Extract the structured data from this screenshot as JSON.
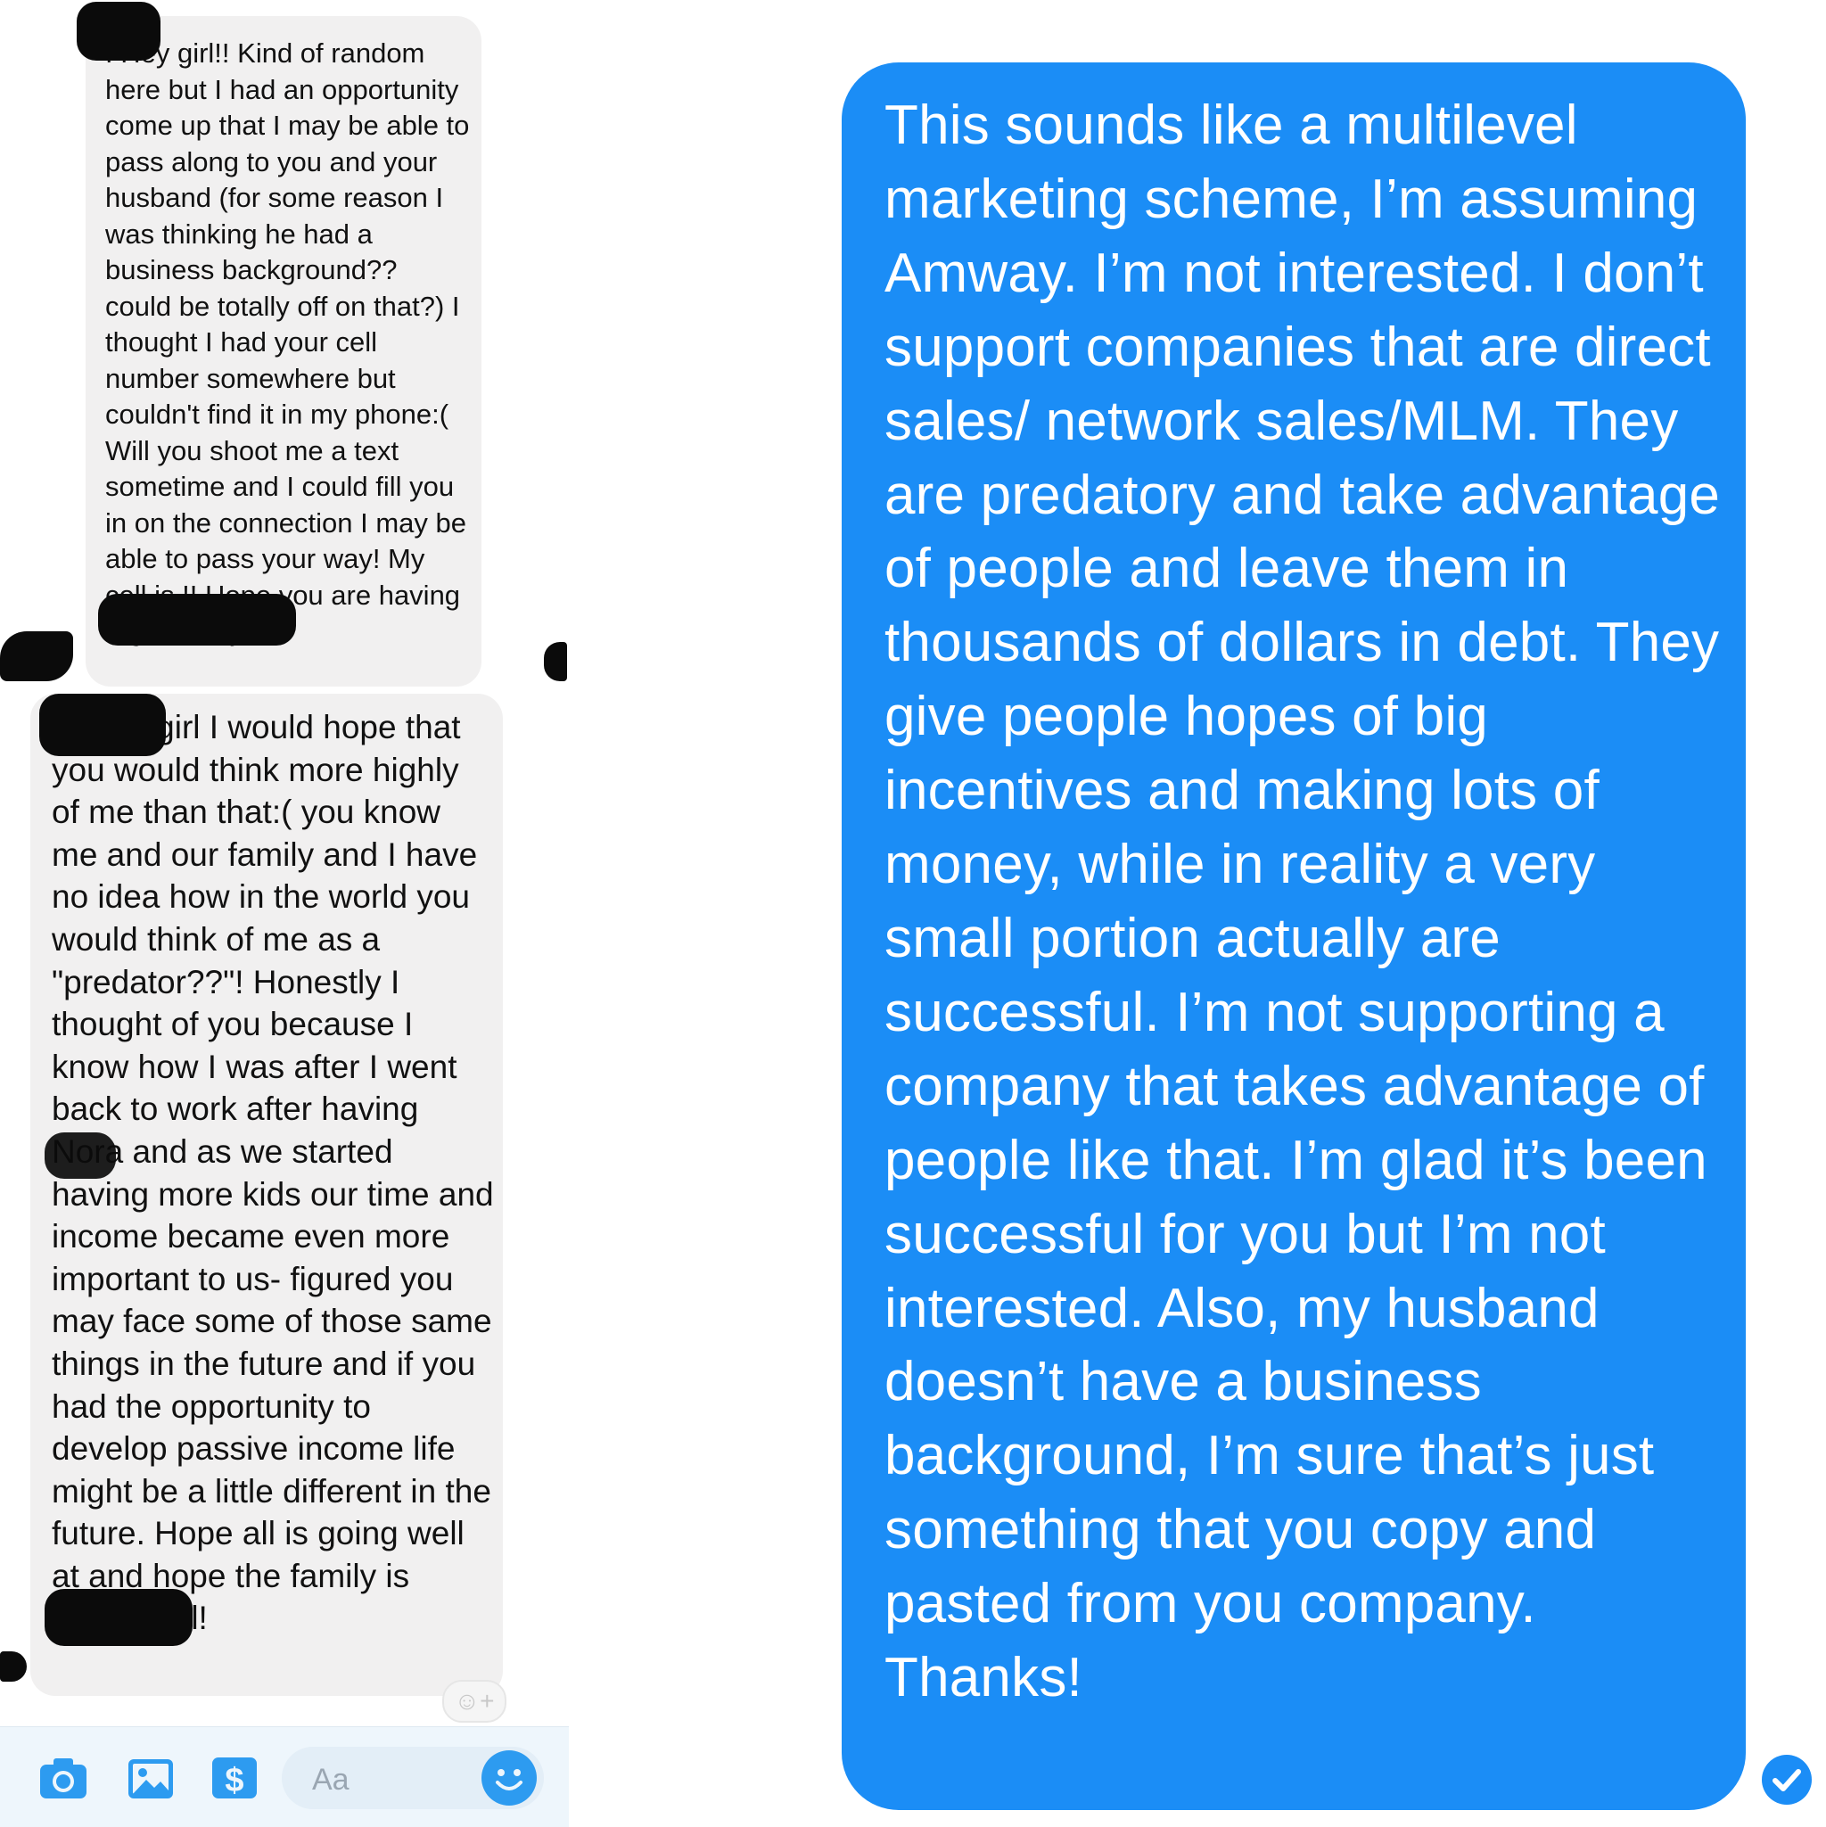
{
  "conversation": {
    "received_1": {
      "text": "! Hey girl!! Kind of random here but I had an opportunity come up that I may be able to pass along to you and your husband (for some reason I was thinking he had a business background?? could be totally off on that?) I thought I had your cell number somewhere but couldn't find it in my phone:( Will you shoot me a text sometime and I could fill you in on the connection I may be able to pass your way! My cell is !! Hope you are having a great day!!!"
    },
    "received_2": {
      "text": "WOW. girl I would hope that you would think more highly of me than that:( you know me and our family and I have no idea how in the world you would think of me as a \"predator??\"! Honestly I thought of you because I know how I was after I went back to work after having Nora and as we started having more kids our time and income became even more important to us- figured you may face some of those same things in the future and if you had the opportunity to develop passive income life might be a little different in the future. Hope all is going well at and hope the family is doing well!"
    },
    "sent_1": {
      "text": "This sounds like a multilevel marketing scheme, I’m assuming Amway. I’m not interested. I don’t support companies that are direct sales/ network sales/MLM. They are predatory and take advantage of people and leave them in thousands of dollars in debt. They give people hopes of big incentives and making lots of money, while in reality a very small portion actually are successful. I’m not supporting a company that takes advantage of people like that. I’m glad it’s been successful for you but I’m not interested. Also, my husband doesn’t have a business background, I’m sure that’s just something that you copy and pasted from you company. Thanks!"
    }
  },
  "composer": {
    "placeholder": "Aa",
    "tools": [
      "camera-icon",
      "photo-icon",
      "payment-icon",
      "emoji-icon"
    ]
  },
  "reaction_icon": "add-reaction-icon",
  "status_icon": "seen-check-icon",
  "colors": {
    "sent_bubble": "#1b8df6",
    "received_bubble": "#f1f0f0",
    "accent": "#2d9bf0"
  }
}
